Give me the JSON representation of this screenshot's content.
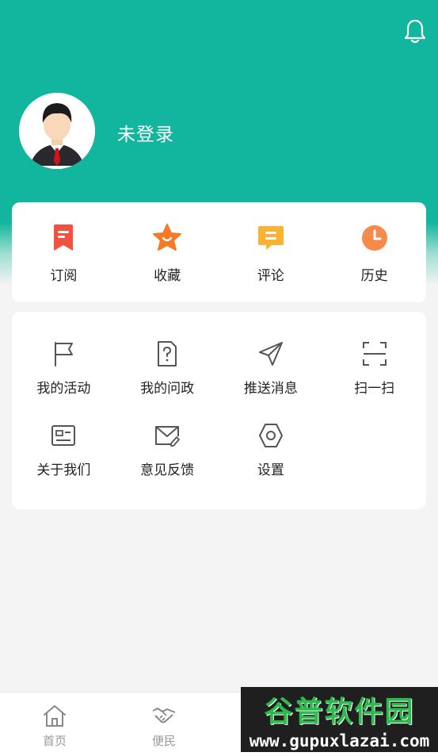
{
  "header": {
    "username": "未登录",
    "bell_icon": "bell-icon",
    "accent_color": "#12b59d"
  },
  "quick_actions": [
    {
      "label": "订阅",
      "icon": "bookmark-icon"
    },
    {
      "label": "收藏",
      "icon": "star-icon"
    },
    {
      "label": "评论",
      "icon": "comment-icon"
    },
    {
      "label": "历史",
      "icon": "clock-icon"
    }
  ],
  "menu": [
    {
      "label": "我的活动",
      "icon": "flag-icon"
    },
    {
      "label": "我的问政",
      "icon": "question-doc-icon"
    },
    {
      "label": "推送消息",
      "icon": "send-icon"
    },
    {
      "label": "扫一扫",
      "icon": "scan-icon"
    },
    {
      "label": "关于我们",
      "icon": "id-card-icon"
    },
    {
      "label": "意见反馈",
      "icon": "mail-edit-icon"
    },
    {
      "label": "设置",
      "icon": "hexagon-settings-icon"
    }
  ],
  "tabbar": [
    {
      "label": "首页",
      "icon": "home-icon"
    },
    {
      "label": "便民",
      "icon": "handshake-icon"
    }
  ],
  "watermark": {
    "title": "谷普软件园",
    "url": "www.gupuxlazai.com"
  }
}
